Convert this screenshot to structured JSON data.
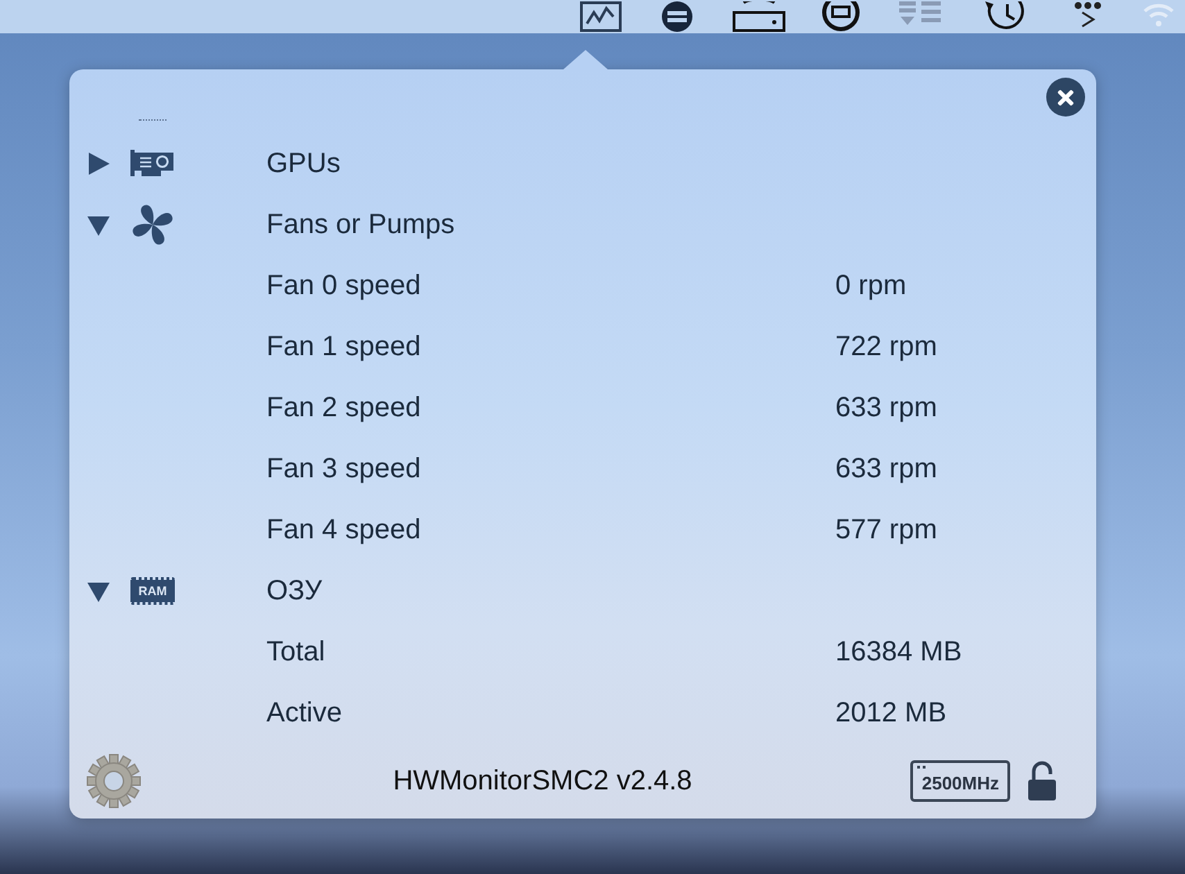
{
  "groups": [
    {
      "kind": "gpu",
      "label": "GPUs",
      "expanded": false
    },
    {
      "kind": "fan",
      "label": "Fans or Pumps",
      "expanded": true,
      "children": [
        {
          "label": "Fan 0 speed",
          "value": "0 rpm"
        },
        {
          "label": "Fan 1 speed",
          "value": "722 rpm"
        },
        {
          "label": "Fan 2 speed",
          "value": "633 rpm"
        },
        {
          "label": "Fan 3 speed",
          "value": "633 rpm"
        },
        {
          "label": "Fan 4 speed",
          "value": "577 rpm"
        }
      ]
    },
    {
      "kind": "ram",
      "label": "ОЗУ",
      "icon_label": "RAM",
      "expanded": true,
      "children": [
        {
          "label": "Total",
          "value": "16384 MB"
        },
        {
          "label": "Active",
          "value": "2012 MB"
        }
      ]
    }
  ],
  "footer": {
    "title": "HWMonitorSMC2 v2.4.8",
    "cpu_badge": "2500MHz",
    "locked": false
  }
}
